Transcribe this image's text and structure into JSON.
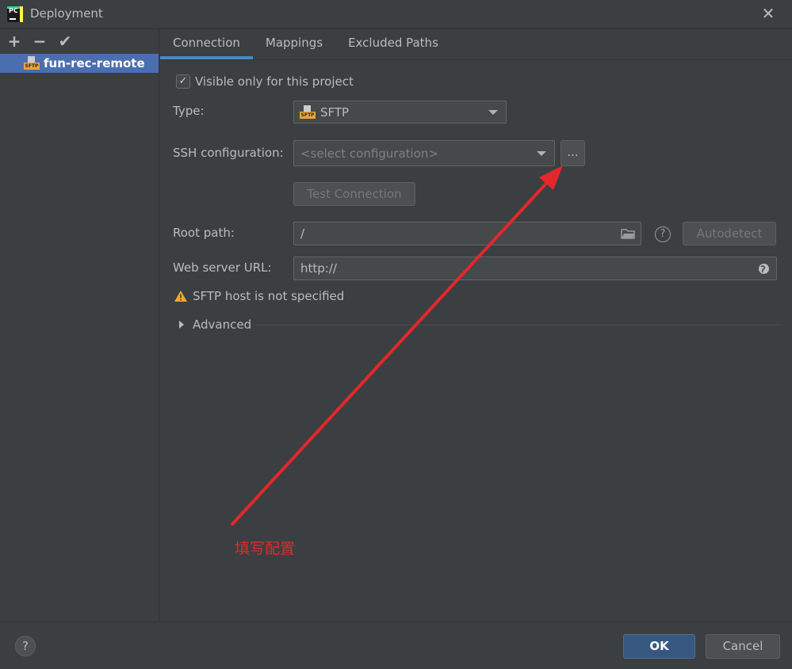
{
  "window": {
    "title": "Deployment"
  },
  "sidebar": {
    "items": [
      {
        "label": "fun-rec-remote",
        "icon_text": "SFTP"
      }
    ]
  },
  "tabs": [
    {
      "label": "Connection"
    },
    {
      "label": "Mappings"
    },
    {
      "label": "Excluded Paths"
    }
  ],
  "form": {
    "visible_only_label": "Visible only for this project",
    "type_label": "Type:",
    "type_value": "SFTP",
    "ssh_label": "SSH configuration:",
    "ssh_placeholder": "<select configuration>",
    "browse_label": "...",
    "test_connection": "Test Connection",
    "root_path_label": "Root path:",
    "root_path_value": "/",
    "autodetect": "Autodetect",
    "web_url_label": "Web server URL:",
    "web_url_value": "http://",
    "warning": "SFTP host is not specified",
    "advanced": "Advanced"
  },
  "annotation": {
    "text": "填写配置",
    "color": "#e3272b"
  },
  "footer": {
    "ok": "OK",
    "cancel": "Cancel",
    "help": "?"
  }
}
